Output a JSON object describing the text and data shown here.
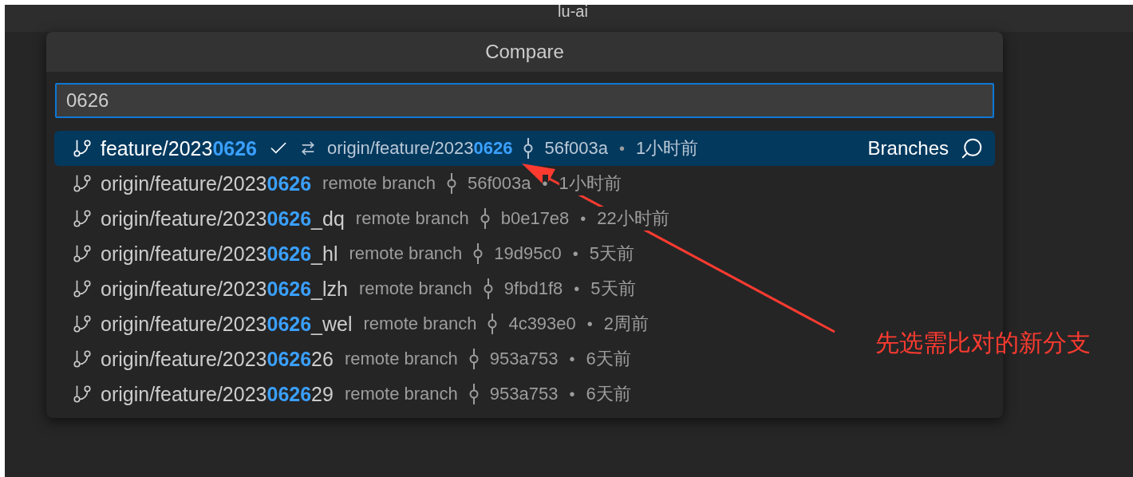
{
  "window": {
    "title": "lu-ai"
  },
  "quick_pick": {
    "title": "Compare",
    "input": {
      "value": "0626"
    },
    "items": [
      {
        "kind": "current",
        "label": "feature/2023**0626**",
        "checked": true,
        "upstream": "origin/feature/2023**0626**",
        "sha": "56f003a",
        "separator": "•",
        "time": "1小时前",
        "category": "Branches",
        "selected": true
      },
      {
        "kind": "remote",
        "label": "origin/feature/2023**0626**",
        "description": "remote branch",
        "sha": "56f003a",
        "separator": "•",
        "time": "1小时前",
        "selected": false
      },
      {
        "kind": "remote",
        "label": "origin/feature/2023**0626**_dq",
        "description": "remote branch",
        "sha": "b0e17e8",
        "separator": "•",
        "time": "22小时前",
        "selected": false
      },
      {
        "kind": "remote",
        "label": "origin/feature/2023**0626**_hl",
        "description": "remote branch",
        "sha": "19d95c0",
        "separator": "•",
        "time": "5天前",
        "selected": false
      },
      {
        "kind": "remote",
        "label": "origin/feature/2023**0626**_lzh",
        "description": "remote branch",
        "sha": "9fbd1f8",
        "separator": "•",
        "time": "5天前",
        "selected": false
      },
      {
        "kind": "remote",
        "label": "origin/feature/2023**0626**_wel",
        "description": "remote branch",
        "sha": "4c393e0",
        "separator": "•",
        "time": "2周前",
        "selected": false
      },
      {
        "kind": "remote",
        "label": "origin/feature/2023**0626**26",
        "description": "remote branch",
        "sha": "953a753",
        "separator": "•",
        "time": "6天前",
        "selected": false
      },
      {
        "kind": "remote",
        "label": "origin/feature/2023**0626**29",
        "description": "remote branch",
        "sha": "953a753",
        "separator": "•",
        "time": "6天前",
        "selected": false
      }
    ]
  },
  "annotation": {
    "text": "先选需比对的新分支"
  }
}
